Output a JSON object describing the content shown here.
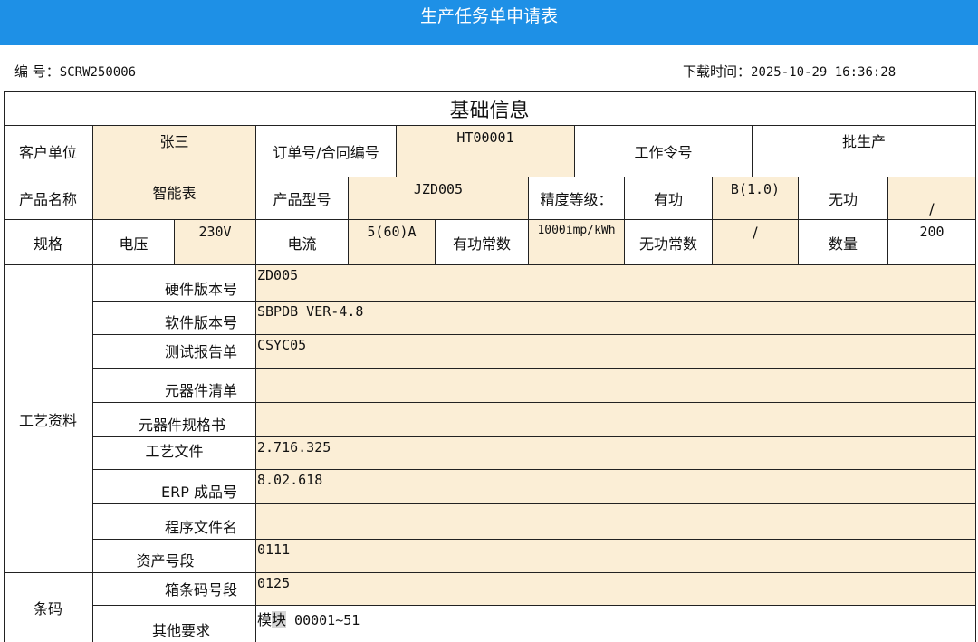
{
  "header": {
    "title": "生产任务单申请表"
  },
  "meta": {
    "number_label": "编 号：",
    "number": "SCRW250006",
    "download_label": "下载时间：",
    "download_time": "2025-10-29 16:36:28"
  },
  "section_basic": "基础信息",
  "row1": {
    "customer_label": "客户单位",
    "customer": "张三",
    "order_label": "订单号/合同编号",
    "order": "HT00001",
    "work_order_label": "工作令号",
    "work_order": "批生产"
  },
  "row2": {
    "product_name_label": "产品名称",
    "product_name": "智能表",
    "model_label": "产品型号",
    "model": "JZD005",
    "accuracy_label": "精度等级：",
    "active_label": "有功",
    "active": "B(1.0)",
    "reactive_label": "无功",
    "reactive": "/"
  },
  "row3": {
    "spec_label": "规格",
    "voltage_label": "电压",
    "voltage": "230V",
    "current_label": "电流",
    "current": "5(60)A",
    "active_const_label": "有功常数",
    "active_const": "1000imp/kWh",
    "reactive_const_label": "无功常数",
    "reactive_const": "/",
    "qty_label": "数量",
    "qty": "200"
  },
  "process": {
    "label": "工艺资料",
    "items": [
      {
        "label": "硬件版本号",
        "value": "ZD005"
      },
      {
        "label": "软件版本号",
        "value": "SBPDB VER-4.8"
      },
      {
        "label": "测试报告单",
        "value": "CSYC05"
      },
      {
        "label": "元器件清单",
        "value": ""
      },
      {
        "label": "元器件规格书",
        "value": ""
      },
      {
        "label": "工艺文件",
        "value": "2.716.325"
      },
      {
        "label": "ERP 成品号",
        "value": "8.02.618"
      },
      {
        "label": "程序文件名",
        "value": ""
      },
      {
        "label": "资产号段",
        "value": "0111"
      }
    ]
  },
  "barcode": {
    "label": "条码",
    "box_label": "箱条码号段",
    "box_value": "0125",
    "other_label": "其他要求",
    "other_prefix": "模",
    "other_highlight": "块",
    "other_suffix": " 00001~51"
  }
}
